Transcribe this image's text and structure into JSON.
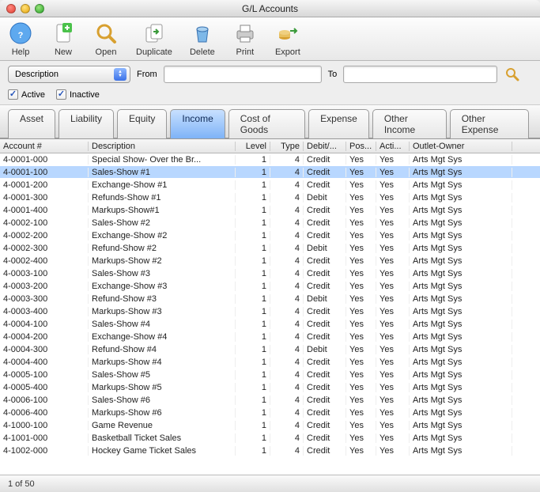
{
  "window": {
    "title": "G/L Accounts"
  },
  "toolbar": {
    "help": "Help",
    "new": "New",
    "open": "Open",
    "duplicate": "Duplicate",
    "delete": "Delete",
    "print": "Print",
    "export": "Export"
  },
  "filter": {
    "field": "Description",
    "from_label": "From",
    "from_value": "",
    "to_label": "To",
    "to_value": ""
  },
  "checks": {
    "active": "Active",
    "inactive": "Inactive",
    "active_on": true,
    "inactive_on": true
  },
  "tabs": {
    "items": [
      "Asset",
      "Liability",
      "Equity",
      "Income",
      "Cost of Goods",
      "Expense",
      "Other Income",
      "Other Expense"
    ],
    "selected": 3
  },
  "columns": [
    "Account #",
    "Description",
    "Level",
    "Type",
    "Debit/...",
    "Pos...",
    "Acti...",
    "Outlet-Owner"
  ],
  "rows": [
    {
      "acct": "4-0001-000",
      "desc": "Special Show- Over the Br...",
      "level": "1",
      "type": "4",
      "dc": "Credit",
      "post": "Yes",
      "active": "Yes",
      "outlet": "Arts Mgt Sys",
      "sel": false
    },
    {
      "acct": "4-0001-100",
      "desc": "Sales-Show #1",
      "level": "1",
      "type": "4",
      "dc": "Credit",
      "post": "Yes",
      "active": "Yes",
      "outlet": "Arts Mgt Sys",
      "sel": true
    },
    {
      "acct": "4-0001-200",
      "desc": "Exchange-Show #1",
      "level": "1",
      "type": "4",
      "dc": "Credit",
      "post": "Yes",
      "active": "Yes",
      "outlet": "Arts Mgt Sys",
      "sel": false
    },
    {
      "acct": "4-0001-300",
      "desc": "Refunds-Show #1",
      "level": "1",
      "type": "4",
      "dc": "Debit",
      "post": "Yes",
      "active": "Yes",
      "outlet": "Arts Mgt Sys",
      "sel": false
    },
    {
      "acct": "4-0001-400",
      "desc": "Markups-Show#1",
      "level": "1",
      "type": "4",
      "dc": "Credit",
      "post": "Yes",
      "active": "Yes",
      "outlet": "Arts Mgt Sys",
      "sel": false
    },
    {
      "acct": "4-0002-100",
      "desc": "Sales-Show #2",
      "level": "1",
      "type": "4",
      "dc": "Credit",
      "post": "Yes",
      "active": "Yes",
      "outlet": "Arts Mgt Sys",
      "sel": false
    },
    {
      "acct": "4-0002-200",
      "desc": "Exchange-Show #2",
      "level": "1",
      "type": "4",
      "dc": "Credit",
      "post": "Yes",
      "active": "Yes",
      "outlet": "Arts Mgt Sys",
      "sel": false
    },
    {
      "acct": "4-0002-300",
      "desc": "Refund-Show #2",
      "level": "1",
      "type": "4",
      "dc": "Debit",
      "post": "Yes",
      "active": "Yes",
      "outlet": "Arts Mgt Sys",
      "sel": false
    },
    {
      "acct": "4-0002-400",
      "desc": "Markups-Show #2",
      "level": "1",
      "type": "4",
      "dc": "Credit",
      "post": "Yes",
      "active": "Yes",
      "outlet": "Arts Mgt Sys",
      "sel": false
    },
    {
      "acct": "4-0003-100",
      "desc": "Sales-Show #3",
      "level": "1",
      "type": "4",
      "dc": "Credit",
      "post": "Yes",
      "active": "Yes",
      "outlet": "Arts Mgt Sys",
      "sel": false
    },
    {
      "acct": "4-0003-200",
      "desc": "Exchange-Show #3",
      "level": "1",
      "type": "4",
      "dc": "Credit",
      "post": "Yes",
      "active": "Yes",
      "outlet": "Arts Mgt Sys",
      "sel": false
    },
    {
      "acct": "4-0003-300",
      "desc": "Refund-Show #3",
      "level": "1",
      "type": "4",
      "dc": "Debit",
      "post": "Yes",
      "active": "Yes",
      "outlet": "Arts Mgt Sys",
      "sel": false
    },
    {
      "acct": "4-0003-400",
      "desc": "Markups-Show #3",
      "level": "1",
      "type": "4",
      "dc": "Credit",
      "post": "Yes",
      "active": "Yes",
      "outlet": "Arts Mgt Sys",
      "sel": false
    },
    {
      "acct": "4-0004-100",
      "desc": "Sales-Show #4",
      "level": "1",
      "type": "4",
      "dc": "Credit",
      "post": "Yes",
      "active": "Yes",
      "outlet": "Arts Mgt Sys",
      "sel": false
    },
    {
      "acct": "4-0004-200",
      "desc": "Exchange-Show #4",
      "level": "1",
      "type": "4",
      "dc": "Credit",
      "post": "Yes",
      "active": "Yes",
      "outlet": "Arts Mgt Sys",
      "sel": false
    },
    {
      "acct": "4-0004-300",
      "desc": "Refund-Show #4",
      "level": "1",
      "type": "4",
      "dc": "Debit",
      "post": "Yes",
      "active": "Yes",
      "outlet": "Arts Mgt Sys",
      "sel": false
    },
    {
      "acct": "4-0004-400",
      "desc": "Markups-Show #4",
      "level": "1",
      "type": "4",
      "dc": "Credit",
      "post": "Yes",
      "active": "Yes",
      "outlet": "Arts Mgt Sys",
      "sel": false
    },
    {
      "acct": "4-0005-100",
      "desc": "Sales-Show #5",
      "level": "1",
      "type": "4",
      "dc": "Credit",
      "post": "Yes",
      "active": "Yes",
      "outlet": "Arts Mgt Sys",
      "sel": false
    },
    {
      "acct": "4-0005-400",
      "desc": "Markups-Show #5",
      "level": "1",
      "type": "4",
      "dc": "Credit",
      "post": "Yes",
      "active": "Yes",
      "outlet": "Arts Mgt Sys",
      "sel": false
    },
    {
      "acct": "4-0006-100",
      "desc": "Sales-Show #6",
      "level": "1",
      "type": "4",
      "dc": "Credit",
      "post": "Yes",
      "active": "Yes",
      "outlet": "Arts Mgt Sys",
      "sel": false
    },
    {
      "acct": "4-0006-400",
      "desc": "Markups-Show #6",
      "level": "1",
      "type": "4",
      "dc": "Credit",
      "post": "Yes",
      "active": "Yes",
      "outlet": "Arts Mgt Sys",
      "sel": false
    },
    {
      "acct": "4-1000-100",
      "desc": "Game Revenue",
      "level": "1",
      "type": "4",
      "dc": "Credit",
      "post": "Yes",
      "active": "Yes",
      "outlet": "Arts Mgt Sys",
      "sel": false
    },
    {
      "acct": "4-1001-000",
      "desc": "Basketball Ticket Sales",
      "level": "1",
      "type": "4",
      "dc": "Credit",
      "post": "Yes",
      "active": "Yes",
      "outlet": "Arts Mgt Sys",
      "sel": false
    },
    {
      "acct": "4-1002-000",
      "desc": "Hockey Game Ticket Sales",
      "level": "1",
      "type": "4",
      "dc": "Credit",
      "post": "Yes",
      "active": "Yes",
      "outlet": "Arts Mgt Sys",
      "sel": false
    }
  ],
  "status": "1 of 50"
}
